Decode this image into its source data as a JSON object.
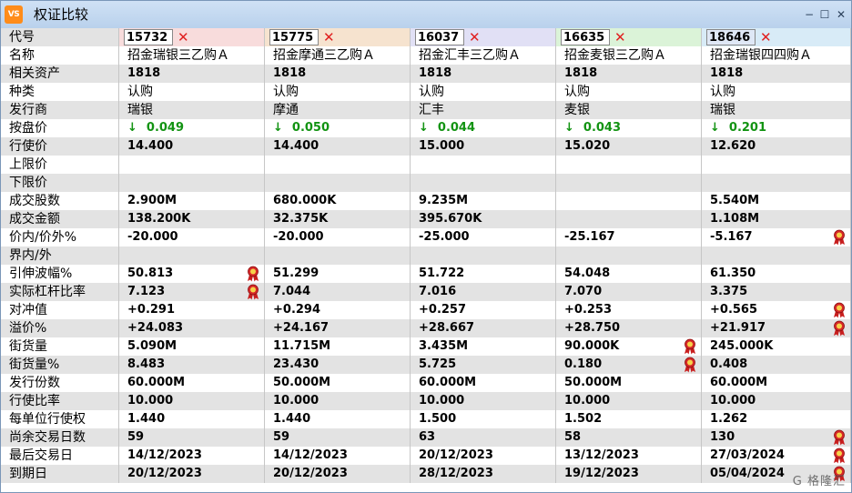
{
  "window": {
    "title": "权证比较",
    "icon_text": "VS"
  },
  "header": {
    "label": "代号",
    "codes": [
      "15732",
      "15775",
      "16037",
      "16635",
      "18646"
    ],
    "colors": [
      "#f8dcdc",
      "#f6e3cf",
      "#e1e0f5",
      "#dbf3d8",
      "#d8ebf7"
    ]
  },
  "labels": [
    "名称",
    "相关资产",
    "种类",
    "发行商",
    "按盘价",
    "行使价",
    "上限价",
    "下限价",
    "成交股数",
    "成交金额",
    "价内/价外%",
    "界内/外",
    "引伸波幅%",
    "实际杠杆比率",
    "对冲值",
    "溢价%",
    "街货量",
    "街货量%",
    "发行份数",
    "行使比率",
    "每单位行使权",
    "尚余交易日数",
    "最后交易日",
    "到期日"
  ],
  "columns": [
    {
      "name": "招金瑞银三乙购Ａ",
      "asset": "1818",
      "type": "认购",
      "issuer": "瑞银",
      "price": "0.049",
      "strike": "14.400",
      "cap": "",
      "floor": "",
      "volume": "2.900M",
      "turnover": "138.200K",
      "moneyness": "-20.000",
      "inout": "",
      "iv": "50.813",
      "leverage": "7.123",
      "delta": "+0.291",
      "premium": "+24.083",
      "outstanding": "5.090M",
      "outstanding_pct": "8.483",
      "issue_size": "60.000M",
      "ratio": "10.000",
      "per_unit": "1.440",
      "days": "59",
      "last_trade": "14/12/2023",
      "expiry": "20/12/2023"
    },
    {
      "name": "招金摩通三乙购Ａ",
      "asset": "1818",
      "type": "认购",
      "issuer": "摩通",
      "price": "0.050",
      "strike": "14.400",
      "cap": "",
      "floor": "",
      "volume": "680.000K",
      "turnover": "32.375K",
      "moneyness": "-20.000",
      "inout": "",
      "iv": "51.299",
      "leverage": "7.044",
      "delta": "+0.294",
      "premium": "+24.167",
      "outstanding": "11.715M",
      "outstanding_pct": "23.430",
      "issue_size": "50.000M",
      "ratio": "10.000",
      "per_unit": "1.440",
      "days": "59",
      "last_trade": "14/12/2023",
      "expiry": "20/12/2023"
    },
    {
      "name": "招金汇丰三乙购Ａ",
      "asset": "1818",
      "type": "认购",
      "issuer": "汇丰",
      "price": "0.044",
      "strike": "15.000",
      "cap": "",
      "floor": "",
      "volume": "9.235M",
      "turnover": "395.670K",
      "moneyness": "-25.000",
      "inout": "",
      "iv": "51.722",
      "leverage": "7.016",
      "delta": "+0.257",
      "premium": "+28.667",
      "outstanding": "3.435M",
      "outstanding_pct": "5.725",
      "issue_size": "60.000M",
      "ratio": "10.000",
      "per_unit": "1.500",
      "days": "63",
      "last_trade": "20/12/2023",
      "expiry": "28/12/2023"
    },
    {
      "name": "招金麦银三乙购Ａ",
      "asset": "1818",
      "type": "认购",
      "issuer": "麦银",
      "price": "0.043",
      "strike": "15.020",
      "cap": "",
      "floor": "",
      "volume": "",
      "turnover": "",
      "moneyness": "-25.167",
      "inout": "",
      "iv": "54.048",
      "leverage": "7.070",
      "delta": "+0.253",
      "premium": "+28.750",
      "outstanding": "90.000K",
      "outstanding_pct": "0.180",
      "issue_size": "50.000M",
      "ratio": "10.000",
      "per_unit": "1.502",
      "days": "58",
      "last_trade": "13/12/2023",
      "expiry": "19/12/2023"
    },
    {
      "name": "招金瑞银四四购Ａ",
      "asset": "1818",
      "type": "认购",
      "issuer": "瑞银",
      "price": "0.201",
      "strike": "12.620",
      "cap": "",
      "floor": "",
      "volume": "5.540M",
      "turnover": "1.108M",
      "moneyness": "-5.167",
      "inout": "",
      "iv": "61.350",
      "leverage": "3.375",
      "delta": "+0.565",
      "premium": "+21.917",
      "outstanding": "245.000K",
      "outstanding_pct": "0.408",
      "issue_size": "60.000M",
      "ratio": "10.000",
      "per_unit": "1.262",
      "days": "130",
      "last_trade": "27/03/2024",
      "expiry": "05/04/2024"
    }
  ],
  "medals": [
    {
      "row": 12,
      "col": 0
    },
    {
      "row": 13,
      "col": 0
    },
    {
      "row": 10,
      "col": 4
    },
    {
      "row": 14,
      "col": 4
    },
    {
      "row": 15,
      "col": 4
    },
    {
      "row": 16,
      "col": 3
    },
    {
      "row": 17,
      "col": 3
    },
    {
      "row": 21,
      "col": 4
    },
    {
      "row": 22,
      "col": 4
    },
    {
      "row": 23,
      "col": 4
    }
  ],
  "price_arrow": "↓",
  "watermark": "G 格隆汇"
}
